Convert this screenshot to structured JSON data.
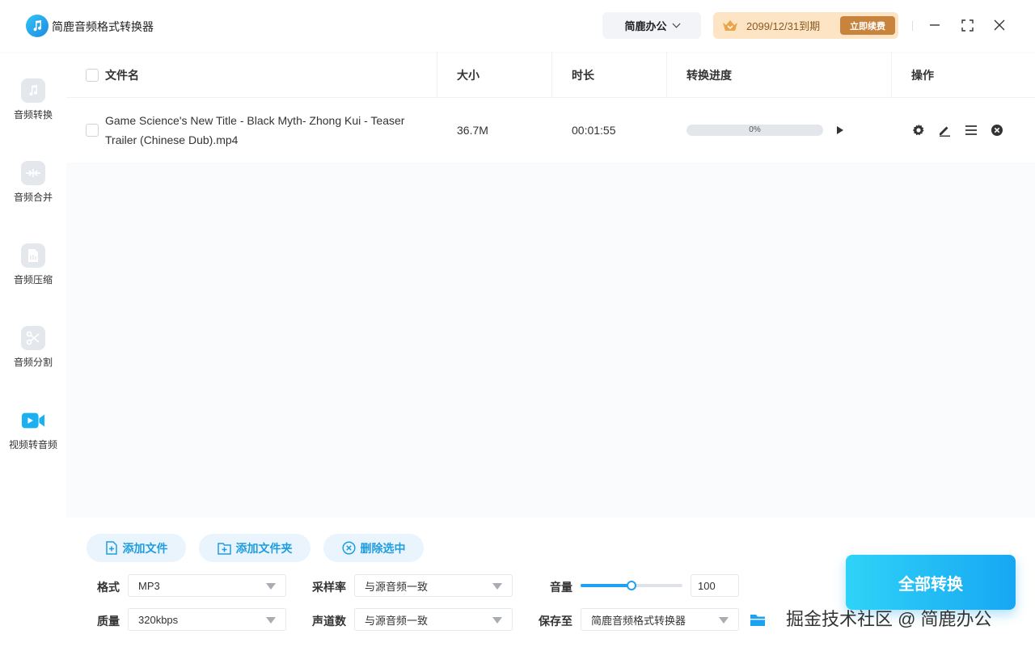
{
  "app": {
    "title": "简鹿音频格式转换器",
    "office_label": "简鹿办公",
    "vip_expiry": "2099/12/31到期",
    "renew_label": "立即续费"
  },
  "sidebar": {
    "items": [
      {
        "label": "音频转换",
        "icon": "music-note-icon"
      },
      {
        "label": "音频合并",
        "icon": "merge-icon"
      },
      {
        "label": "音频压缩",
        "icon": "compress-file-icon"
      },
      {
        "label": "音频分割",
        "icon": "scissors-icon"
      },
      {
        "label": "视频转音频",
        "icon": "video-camera-icon",
        "active": true
      }
    ]
  },
  "table": {
    "columns": [
      "文件名",
      "大小",
      "时长",
      "转换进度",
      "操作"
    ],
    "rows": [
      {
        "filename": "Game Science's New Title - Black Myth- Zhong Kui - Teaser Trailer (Chinese Dub).mp4",
        "size": "36.7M",
        "duration": "00:01:55",
        "progress_text": "0%",
        "progress": 0
      }
    ]
  },
  "actions": {
    "add_file": "添加文件",
    "add_folder": "添加文件夹",
    "delete_selected": "删除选中"
  },
  "settings": {
    "format_label": "格式",
    "format_value": "MP3",
    "quality_label": "质量",
    "quality_value": "320kbps",
    "sample_rate_label": "采样率",
    "sample_rate_value": "与源音频一致",
    "channels_label": "声道数",
    "channels_value": "与源音频一致",
    "volume_label": "音量",
    "volume_value": "100",
    "volume_fraction": 0.5,
    "save_label": "保存至",
    "save_value": "简鹿音频格式转换器"
  },
  "convert_all_label": "全部转换",
  "watermark": "掘金技术社区 @ 简鹿办公",
  "colors": {
    "accent": "#1da1f2",
    "vip_bg": "#fde4c4",
    "renew_bg": "#c8843c"
  }
}
